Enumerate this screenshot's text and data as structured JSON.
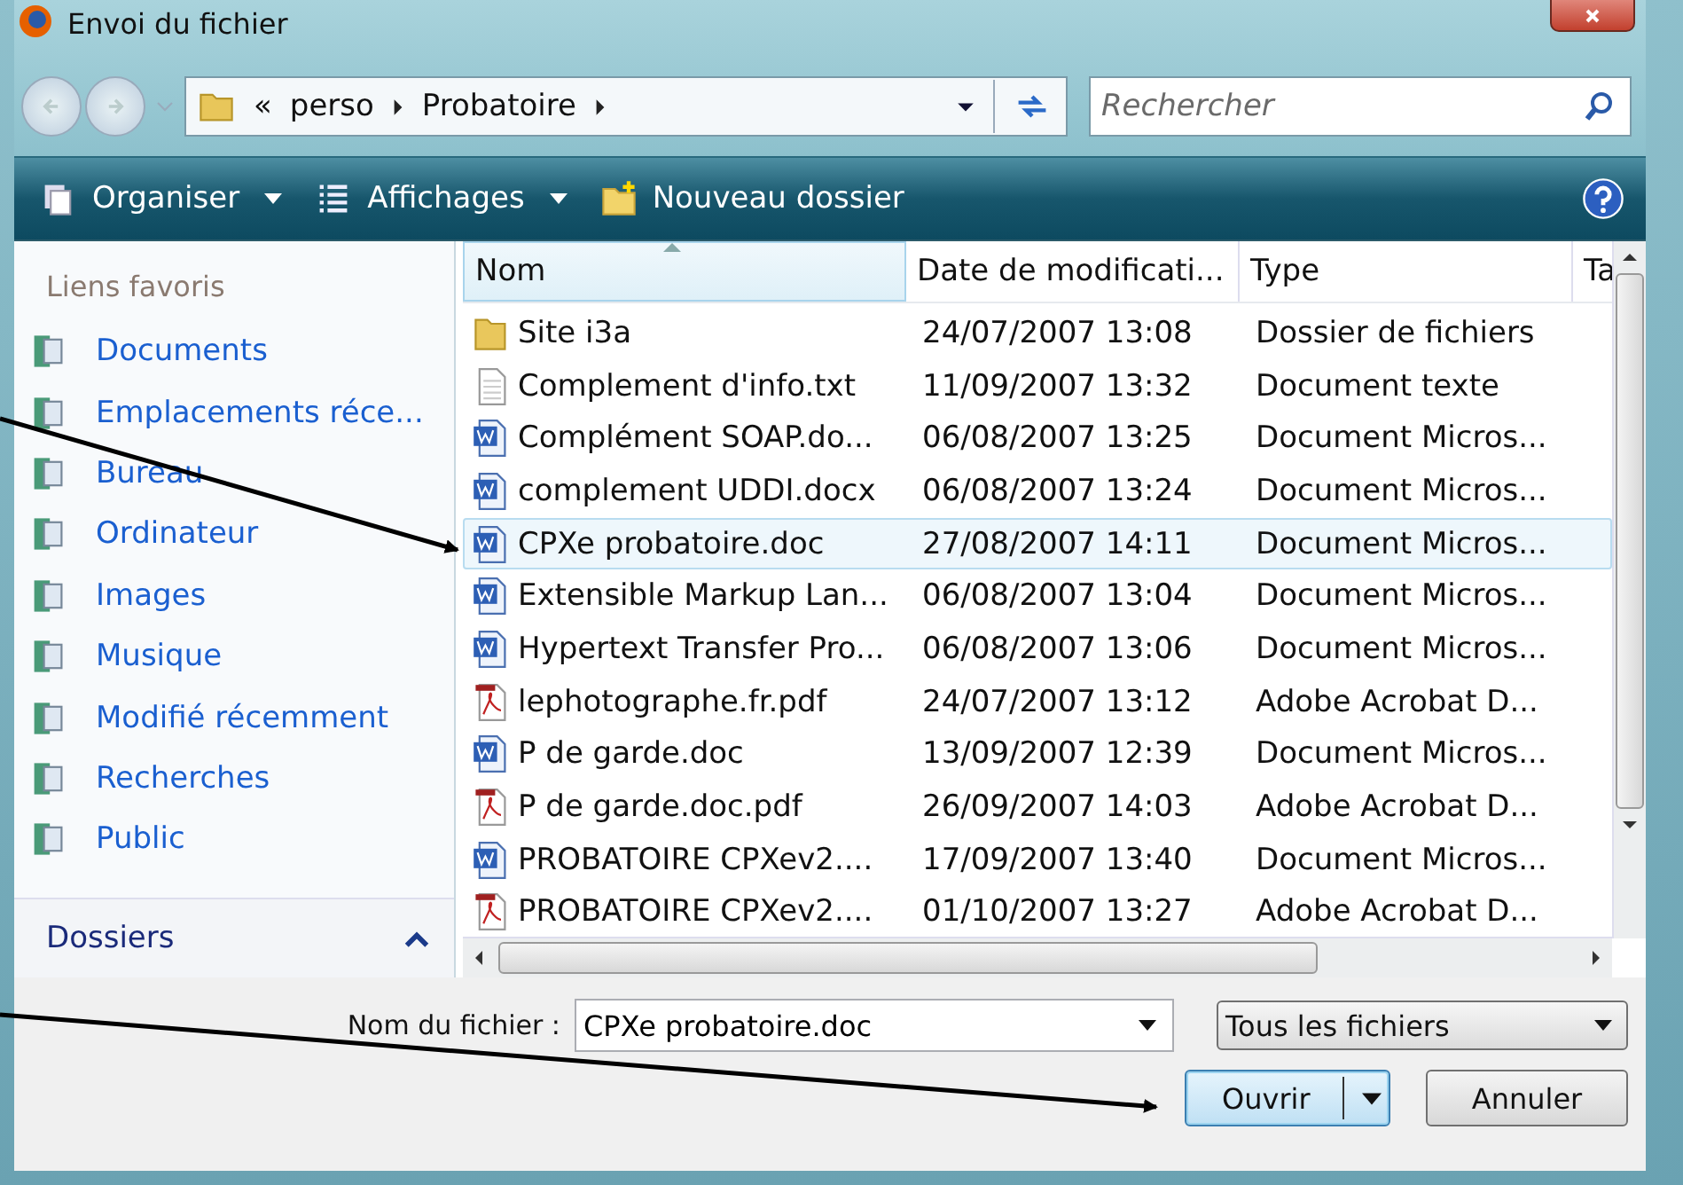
{
  "window": {
    "title": "Envoi du fichier"
  },
  "address": {
    "overflow": "«",
    "crumbs": [
      "perso",
      "Probatoire"
    ]
  },
  "search": {
    "placeholder": "Rechercher"
  },
  "toolbar": [
    {
      "label": "Organiser",
      "kind": "organize",
      "dropdown": true
    },
    {
      "label": "Affichages",
      "kind": "views",
      "dropdown": true
    },
    {
      "label": "Nouveau dossier",
      "kind": "newfolder",
      "dropdown": false
    }
  ],
  "sidebar": {
    "heading": "Liens favoris",
    "items": [
      {
        "label": "Documents"
      },
      {
        "label": "Emplacements réce..."
      },
      {
        "label": "Bureau"
      },
      {
        "label": "Ordinateur"
      },
      {
        "label": "Images"
      },
      {
        "label": "Musique"
      },
      {
        "label": "Modifié récemment"
      },
      {
        "label": "Recherches"
      },
      {
        "label": "Public"
      }
    ],
    "folders": {
      "label": "Dossiers",
      "expanded": true
    }
  },
  "table": {
    "columns": [
      {
        "label": "Nom",
        "sorted": true
      },
      {
        "label": "Date de modificati...",
        "sorted": false
      },
      {
        "label": "Type",
        "sorted": false
      },
      {
        "label": "Ta",
        "sorted": false
      }
    ],
    "rows": [
      {
        "name": "Site i3a",
        "date": "24/07/2007 13:08",
        "type": "Dossier de fichiers",
        "kind": "folder",
        "selected": false
      },
      {
        "name": "Complement d'info.txt",
        "date": "11/09/2007 13:32",
        "type": "Document texte",
        "kind": "text",
        "selected": false
      },
      {
        "name": "Complément SOAP.do...",
        "date": "06/08/2007 13:25",
        "type": "Document Micros...",
        "kind": "word",
        "selected": false
      },
      {
        "name": "complement UDDI.docx",
        "date": "06/08/2007 13:24",
        "type": "Document Micros...",
        "kind": "word",
        "selected": false
      },
      {
        "name": "CPXe probatoire.doc",
        "date": "27/08/2007 14:11",
        "type": "Document Micros...",
        "kind": "word",
        "selected": true
      },
      {
        "name": "Extensible Markup Lan...",
        "date": "06/08/2007 13:04",
        "type": "Document Micros...",
        "kind": "word",
        "selected": false
      },
      {
        "name": "Hypertext Transfer Pro...",
        "date": "06/08/2007 13:06",
        "type": "Document Micros...",
        "kind": "word",
        "selected": false
      },
      {
        "name": "lephotographe.fr.pdf",
        "date": "24/07/2007 13:12",
        "type": "Adobe Acrobat D...",
        "kind": "pdf",
        "selected": false
      },
      {
        "name": "P de garde.doc",
        "date": "13/09/2007 12:39",
        "type": "Document Micros...",
        "kind": "word",
        "selected": false
      },
      {
        "name": "P de garde.doc.pdf",
        "date": "26/09/2007 14:03",
        "type": "Adobe Acrobat D...",
        "kind": "pdf",
        "selected": false
      },
      {
        "name": "PROBATOIRE CPXev2....",
        "date": "17/09/2007 13:40",
        "type": "Document Micros...",
        "kind": "word",
        "selected": false
      },
      {
        "name": "PROBATOIRE CPXev2....",
        "date": "01/10/2007 13:27",
        "type": "Adobe Acrobat D...",
        "kind": "pdf",
        "selected": false
      }
    ]
  },
  "footer": {
    "filename_label": "Nom du fichier :",
    "filename": "CPXe probatoire.doc",
    "filter": "Tous les fichiers",
    "buttons": [
      {
        "label": "Ouvrir",
        "kind": "split",
        "default": true
      },
      {
        "label": "Annuler",
        "kind": "plain",
        "default": false
      }
    ]
  }
}
